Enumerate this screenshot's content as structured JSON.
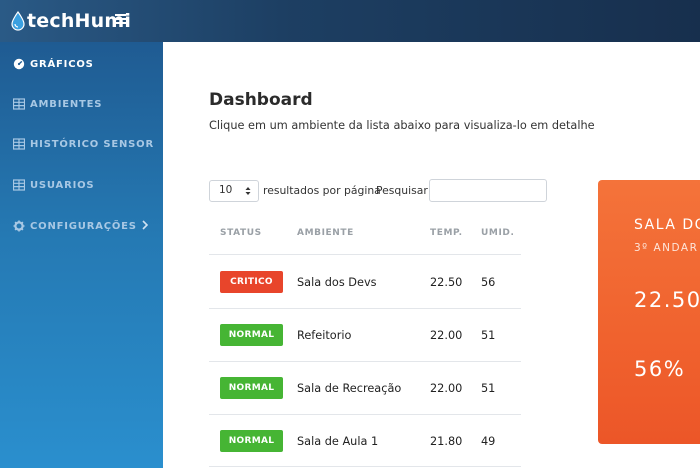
{
  "brand": {
    "logo_text": "techHumi"
  },
  "sidebar": {
    "items": [
      {
        "label": "GRÁFICOS",
        "icon": "gauge-icon"
      },
      {
        "label": "AMBIENTES",
        "icon": "table-icon"
      },
      {
        "label": "HISTÓRICO SENSOR",
        "icon": "table-icon"
      },
      {
        "label": "USUARIOS",
        "icon": "table-icon"
      },
      {
        "label": "CONFIGURAÇÕES",
        "icon": "gear-icon"
      }
    ]
  },
  "main": {
    "title": "Dashboard",
    "subtitle": "Clique em um ambiente da lista abaixo para visualiza-lo em detalhe",
    "page_size": {
      "value": "10"
    },
    "results_label": "resultados por página",
    "search_label": "Pesquisar",
    "search_value": ""
  },
  "table": {
    "headers": [
      "STATUS",
      "AMBIENTE",
      "TEMP.",
      "UMID."
    ],
    "rows": [
      {
        "status": "CRITICO",
        "ambiente": "Sala dos Devs",
        "temp": "22.50",
        "umid": "56"
      },
      {
        "status": "NORMAL",
        "ambiente": "Refeitorio",
        "temp": "22.00",
        "umid": "51"
      },
      {
        "status": "NORMAL",
        "ambiente": "Sala de Recreação",
        "temp": "22.00",
        "umid": "51"
      },
      {
        "status": "NORMAL",
        "ambiente": "Sala de Aula 1",
        "temp": "21.80",
        "umid": "49"
      }
    ]
  },
  "detail_card": {
    "title": "SALA DO",
    "subtitle": "3º ANDAR |",
    "temp": "22.50",
    "umid": "56%"
  },
  "colors": {
    "critico": "#e8452b",
    "normal": "#46b534",
    "card": "#f0622e",
    "sidebar": "#2579b3",
    "topbar": "#1d3f63"
  }
}
